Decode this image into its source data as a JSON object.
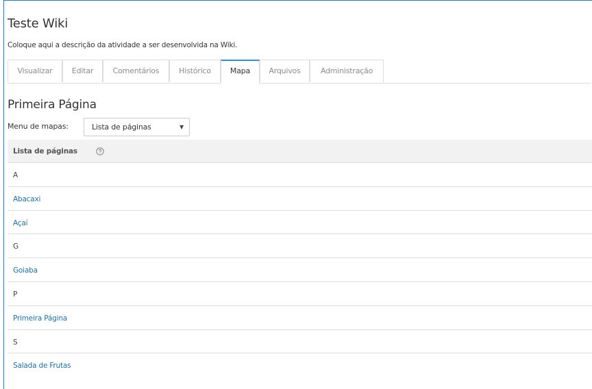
{
  "wiki": {
    "title": "Teste Wiki",
    "description": "Coloque aqui a descrição da atividade a ser desenvolvida na Wiki."
  },
  "tabs": [
    {
      "label": "Visualizar",
      "active": false
    },
    {
      "label": "Editar",
      "active": false
    },
    {
      "label": "Comentários",
      "active": false
    },
    {
      "label": "Histórico",
      "active": false
    },
    {
      "label": "Mapa",
      "active": true
    },
    {
      "label": "Arquivos",
      "active": false
    },
    {
      "label": "Administração",
      "active": false
    }
  ],
  "page": {
    "heading": "Primeira Página",
    "menu_label": "Menu de mapas:",
    "menu_selected": "Lista de páginas"
  },
  "list": {
    "header": "Lista de páginas",
    "help_icon": "question-circle-icon",
    "rows": [
      {
        "text": "A",
        "type": "letter"
      },
      {
        "text": "Abacaxi",
        "type": "link"
      },
      {
        "text": "Açaí",
        "type": "link"
      },
      {
        "text": "G",
        "type": "letter"
      },
      {
        "text": "Goiaba",
        "type": "link"
      },
      {
        "text": "P",
        "type": "letter"
      },
      {
        "text": "Primeira Página",
        "type": "link"
      },
      {
        "text": "S",
        "type": "letter"
      },
      {
        "text": "Salada de Frutas",
        "type": "link"
      }
    ]
  },
  "colors": {
    "frame_border": "#1c78c5",
    "active_tab_accent": "#2c8fd6",
    "link": "#1f6f9f",
    "header_bg": "#f2f2f2"
  }
}
